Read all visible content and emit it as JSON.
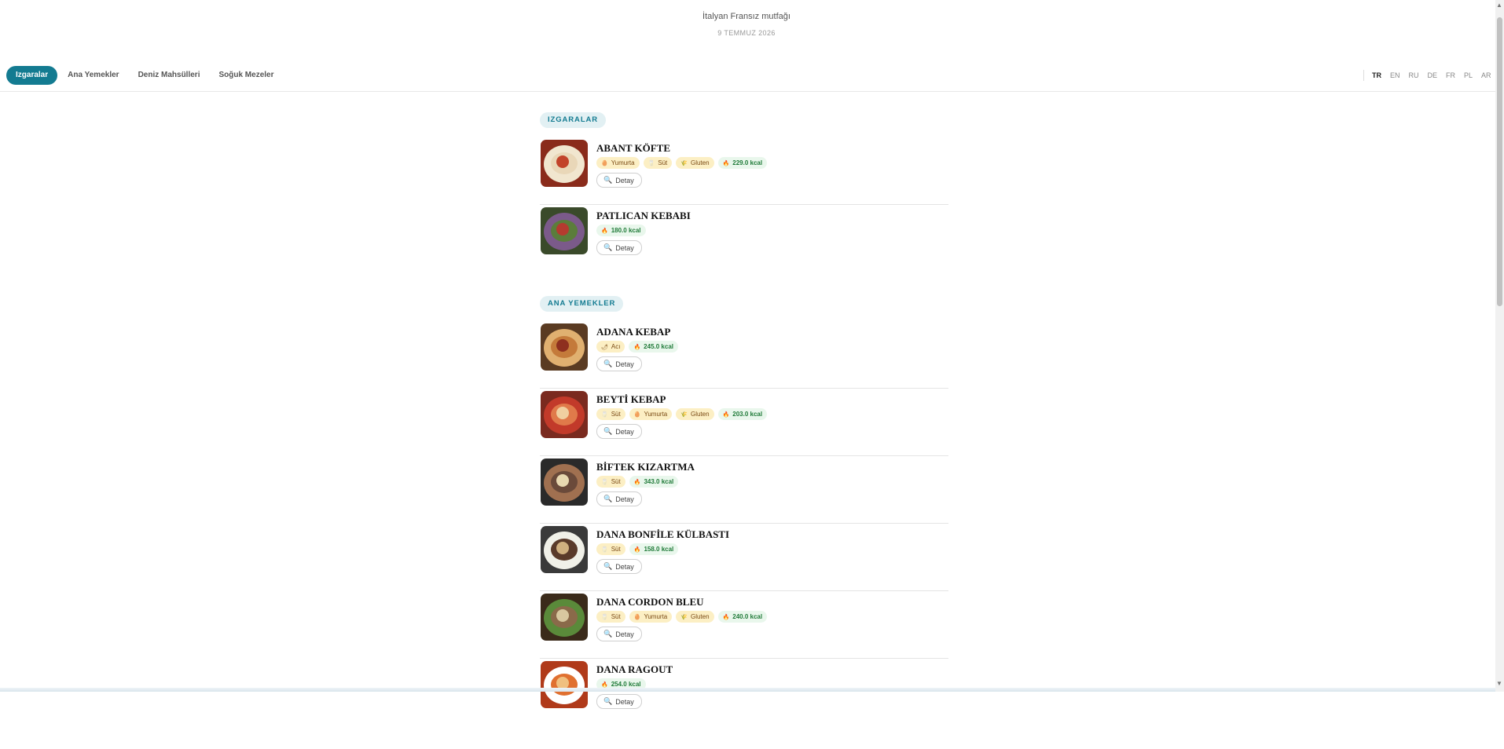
{
  "header": {
    "title": "İtalyan Fransız mutfağı",
    "date": "9 TEMMUZ 2026"
  },
  "tabs": [
    {
      "label": "Izgaralar",
      "active": true
    },
    {
      "label": "Ana Yemekler",
      "active": false
    },
    {
      "label": "Deniz Mahsülleri",
      "active": false
    },
    {
      "label": "Soğuk Mezeler",
      "active": false
    }
  ],
  "languages": [
    "TR",
    "EN",
    "RU",
    "DE",
    "FR",
    "PL",
    "AR"
  ],
  "active_language": "TR",
  "detail_label": "Detay",
  "sections": [
    {
      "title": "IZGARALAR",
      "items": [
        {
          "name": "ABANT KÖFTE",
          "allergens": [
            {
              "label": "Yumurta",
              "icon": "egg-icon"
            },
            {
              "label": "Süt",
              "icon": "milk-icon"
            },
            {
              "label": "Gluten",
              "icon": "wheat-icon"
            }
          ],
          "kcal": "229.0 kcal",
          "image": "plate-food-image"
        },
        {
          "name": "PATLICAN KEBABI",
          "allergens": [],
          "kcal": "180.0 kcal",
          "image": "plate-food-image"
        }
      ]
    },
    {
      "title": "ANA YEMEKLER",
      "items": [
        {
          "name": "ADANA KEBAP",
          "allergens": [
            {
              "label": "Acı",
              "icon": "chili-icon"
            }
          ],
          "kcal": "245.0 kcal",
          "image": "plate-food-image"
        },
        {
          "name": "BEYTİ KEBAP",
          "allergens": [
            {
              "label": "Süt",
              "icon": "milk-icon"
            },
            {
              "label": "Yumurta",
              "icon": "egg-icon"
            },
            {
              "label": "Gluten",
              "icon": "wheat-icon"
            }
          ],
          "kcal": "203.0 kcal",
          "image": "plate-food-image"
        },
        {
          "name": "BİFTEK KIZARTMA",
          "allergens": [
            {
              "label": "Süt",
              "icon": "milk-icon"
            }
          ],
          "kcal": "343.0 kcal",
          "image": "plate-food-image"
        },
        {
          "name": "DANA BONFİLE KÜLBASTI",
          "allergens": [
            {
              "label": "Süt",
              "icon": "milk-icon"
            }
          ],
          "kcal": "158.0 kcal",
          "image": "plate-food-image"
        },
        {
          "name": "DANA CORDON BLEU",
          "allergens": [
            {
              "label": "Süt",
              "icon": "milk-icon"
            },
            {
              "label": "Yumurta",
              "icon": "egg-icon"
            },
            {
              "label": "Gluten",
              "icon": "wheat-icon"
            }
          ],
          "kcal": "240.0 kcal",
          "image": "plate-food-image"
        },
        {
          "name": "DANA RAGOUT",
          "allergens": [],
          "kcal": "254.0 kcal",
          "image": "plate-food-image"
        }
      ]
    }
  ],
  "colors": {
    "accent": "#137b91",
    "section_badge_bg": "#e2f0f3",
    "allergen_bg": "#fcefc4",
    "kcal_bg": "#e9f7ec",
    "kcal_text": "#1f7a38"
  }
}
